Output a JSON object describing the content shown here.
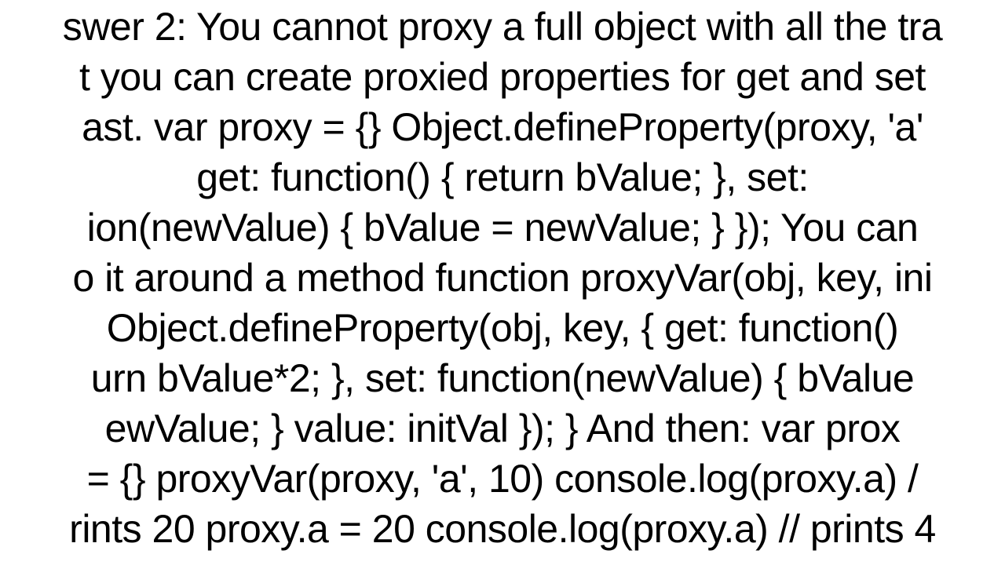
{
  "answer": {
    "text": "swer 2: You cannot proxy a full object with all the tra\nt you can create proxied properties for get and set \nast. var proxy = {}  Object.defineProperty(proxy, 'a'\nget: function() { return bValue; },    set:\nion(newValue) { bValue = newValue; } });  You can \no it around a method function proxyVar(obj, key, ini\nObject.defineProperty(obj, key, {     get: function()\nurn bValue*2; },     set: function(newValue) { bValue\newValue; }     value: initVal   }); }  And then: var prox\n= {}  proxyVar(proxy, 'a', 10)  console.log(proxy.a) /\nrints 20 proxy.a = 20 console.log(proxy.a) // prints 4"
  }
}
